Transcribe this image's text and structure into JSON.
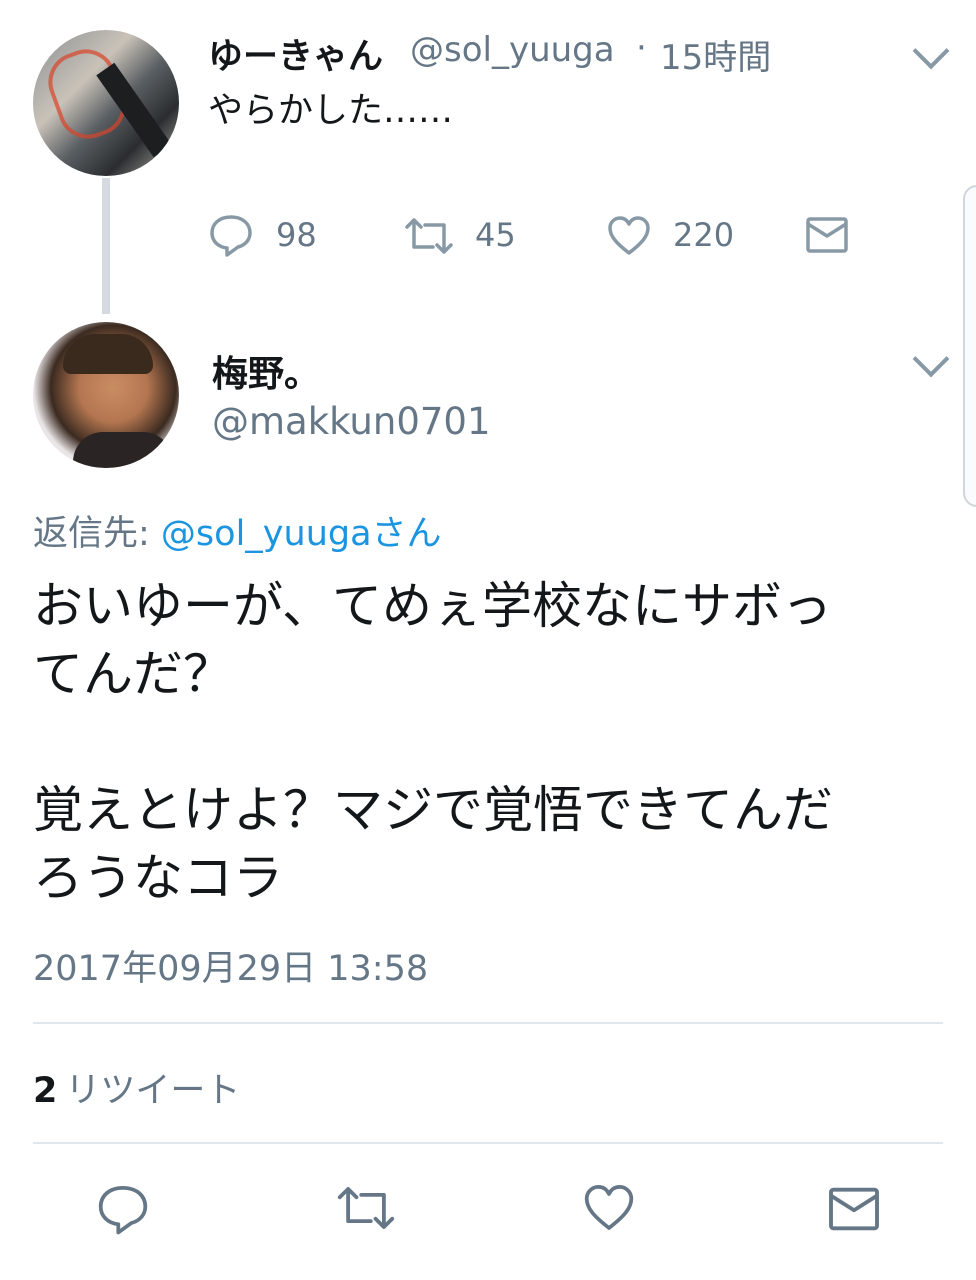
{
  "parent_tweet": {
    "display_name": "ゆーきゃん",
    "handle": "@sol_yuuga",
    "separator": "·",
    "relative_time": "15時間",
    "text": "やらかした……",
    "actions": {
      "reply_count": "98",
      "retweet_count": "45",
      "like_count": "220"
    }
  },
  "reply_tweet": {
    "display_name": "梅野。",
    "handle": "@makkun0701",
    "reply_to_label": "返信先: ",
    "reply_to_mention": "@sol_yuugaさん",
    "body_lines": [
      "おいゆーが、てめぇ学校なにサボっ",
      "てんだ？",
      "覚えとけよ？マジで覚悟できてんだ",
      "ろうなコラ"
    ],
    "timestamp": "2017年09月29日 13:58",
    "retweet_count": "2",
    "retweet_label": "リツイート"
  },
  "icons": {
    "reply": "reply-icon",
    "retweet": "retweet-icon",
    "like": "heart-icon",
    "dm": "mail-icon",
    "menu": "chevron-down-icon"
  },
  "colors": {
    "text": "#14171a",
    "secondary": "#657786",
    "link": "#1b95e0",
    "divider": "#e1e8ed"
  }
}
